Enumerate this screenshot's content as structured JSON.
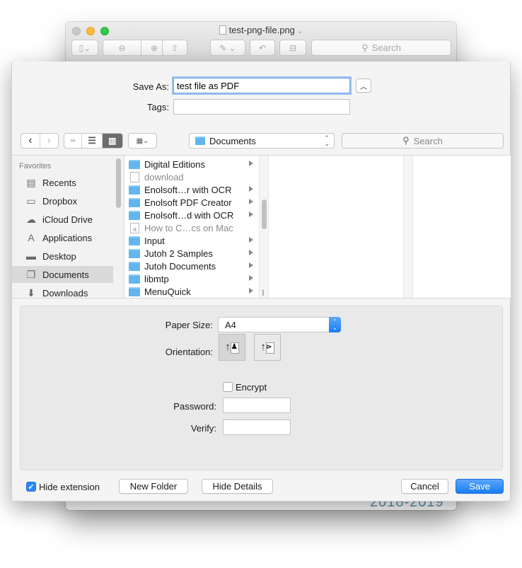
{
  "window": {
    "title": "test-png-file.png",
    "toolbar_search_placeholder": "Search",
    "background_text": "2018-2019"
  },
  "save_panel": {
    "save_as_label": "Save As:",
    "save_as_value": "test file as PDF",
    "tags_label": "Tags:",
    "tags_value": "",
    "location": "Documents",
    "search_placeholder": "Search",
    "sidebar": {
      "header": "Favorites",
      "items": [
        {
          "label": "Recents",
          "icon": "recents-icon"
        },
        {
          "label": "Dropbox",
          "icon": "folder-icon"
        },
        {
          "label": "iCloud Drive",
          "icon": "cloud-icon"
        },
        {
          "label": "Applications",
          "icon": "applications-icon"
        },
        {
          "label": "Desktop",
          "icon": "desktop-icon"
        },
        {
          "label": "Documents",
          "icon": "documents-icon",
          "selected": true
        },
        {
          "label": "Downloads",
          "icon": "downloads-icon"
        }
      ]
    },
    "files": [
      {
        "name": "Digital Editions",
        "type": "folder"
      },
      {
        "name": "download",
        "type": "file",
        "dimmed": true
      },
      {
        "name": "Enolsoft…r with OCR",
        "type": "folder"
      },
      {
        "name": "Enolsoft PDF Creator",
        "type": "folder"
      },
      {
        "name": "Enolsoft…d with OCR",
        "type": "folder"
      },
      {
        "name": "How to C…cs on Mac",
        "type": "file",
        "dimmed": true
      },
      {
        "name": "Input",
        "type": "folder"
      },
      {
        "name": "Jutoh 2 Samples",
        "type": "folder"
      },
      {
        "name": "Jutoh Documents",
        "type": "folder"
      },
      {
        "name": "libmtp",
        "type": "folder"
      },
      {
        "name": "MenuQuick",
        "type": "folder"
      }
    ],
    "details": {
      "paper_size_label": "Paper Size:",
      "paper_size_value": "A4",
      "orientation_label": "Orientation:",
      "orientation_selected": "portrait",
      "encrypt_label": "Encrypt",
      "encrypt_checked": false,
      "password_label": "Password:",
      "verify_label": "Verify:"
    },
    "footer": {
      "hide_extension_label": "Hide extension",
      "hide_extension_checked": true,
      "new_folder": "New Folder",
      "hide_details": "Hide Details",
      "cancel": "Cancel",
      "save": "Save"
    }
  }
}
